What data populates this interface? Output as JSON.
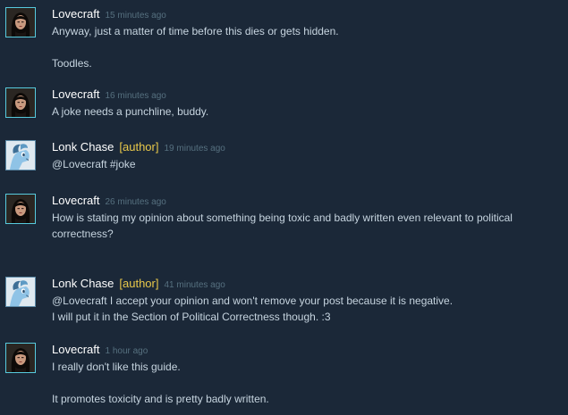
{
  "comments": [
    {
      "author": "Lovecraft",
      "tag": "",
      "time": "15 minutes ago",
      "avatar_icon": "dark-haired-woman-avatar-icon",
      "lines": [
        "Anyway, just a matter of time before this dies or gets hidden.",
        "Toodles."
      ]
    },
    {
      "author": "Lovecraft",
      "tag": "",
      "time": "16 minutes ago",
      "avatar_icon": "dark-haired-woman-avatar-icon",
      "lines": [
        "A joke needs a punchline, buddy."
      ]
    },
    {
      "author": "Lonk Chase",
      "tag": "[author]",
      "time": "19 minutes ago",
      "avatar_icon": "blue-pony-avatar-icon",
      "lines": [
        "@Lovecraft #joke"
      ]
    },
    {
      "author": "Lovecraft",
      "tag": "",
      "time": "26 minutes ago",
      "avatar_icon": "dark-haired-woman-avatar-icon",
      "lines": [
        "How is stating my opinion about something being toxic and badly written even relevant to political correctness?"
      ]
    },
    {
      "author": "Lonk Chase",
      "tag": "[author]",
      "time": "41 minutes ago",
      "avatar_icon": "blue-pony-avatar-icon",
      "lines": [
        "@Lovecraft I accept your opinion and won't remove your post because it is negative.",
        "I will put it in the Section of Political Correctness though. :3"
      ]
    },
    {
      "author": "Lovecraft",
      "tag": "",
      "time": "1 hour ago",
      "avatar_icon": "dark-haired-woman-avatar-icon",
      "lines": [
        "I really don't like this guide.",
        "It promotes toxicity and is pretty badly written."
      ]
    }
  ],
  "colors": {
    "background": "#1b2838",
    "author_name": "#ffffff",
    "author_tag": "#e8c84a",
    "timestamp": "#56707f",
    "comment_text": "#c6d4df"
  }
}
